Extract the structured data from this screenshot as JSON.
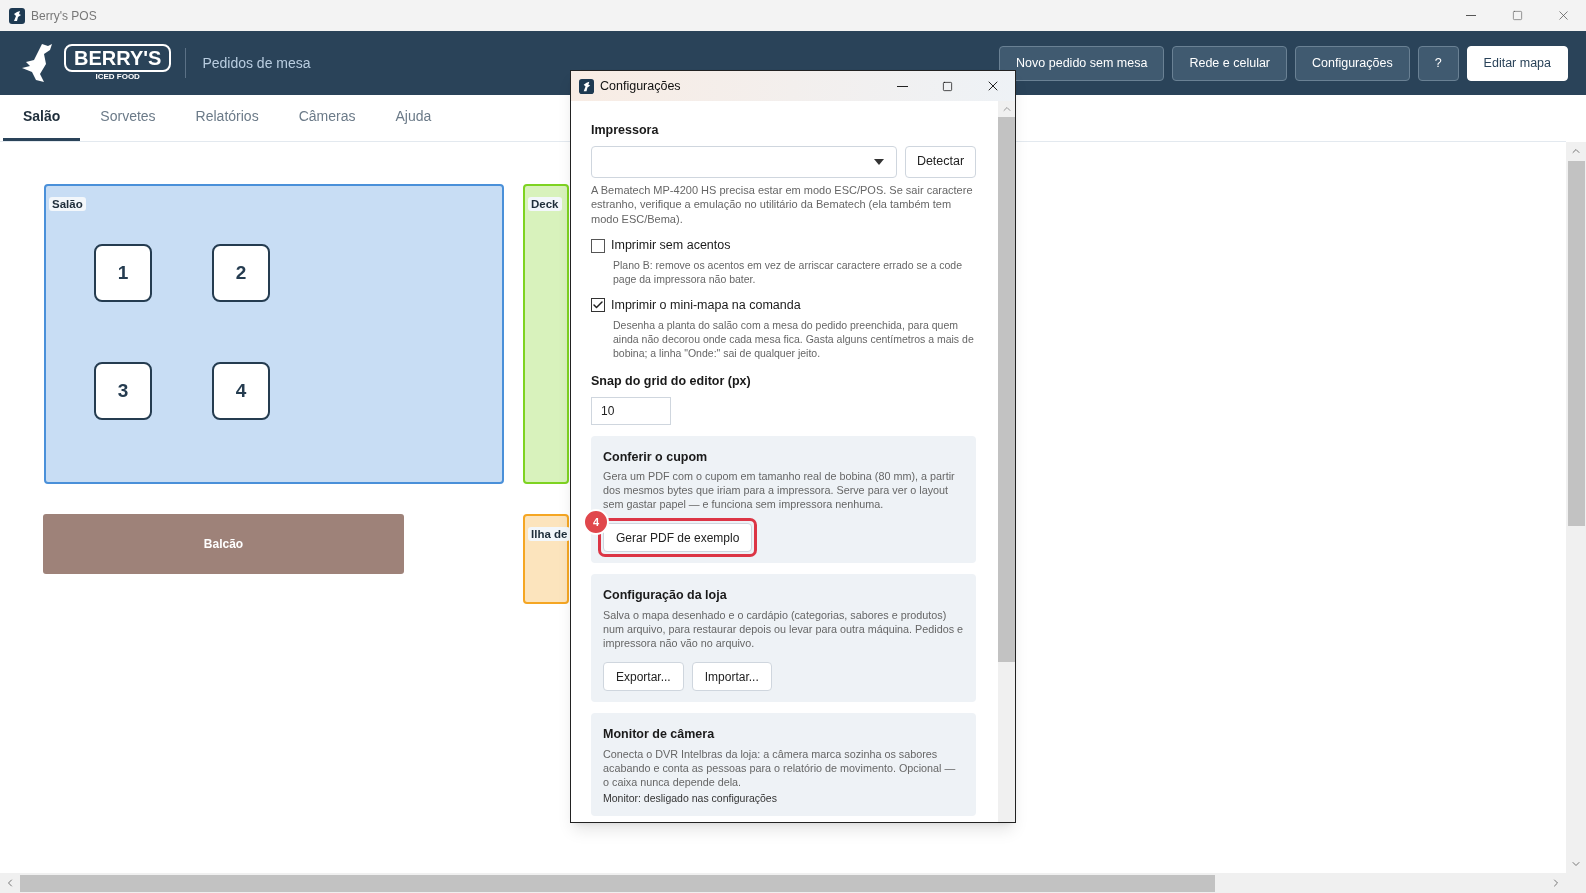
{
  "window": {
    "title": "Berry's POS"
  },
  "header": {
    "logo": {
      "name": "BERRY'S",
      "tagline": "ICED FOOD"
    },
    "subtitle": "Pedidos de mesa",
    "buttons": [
      {
        "label": "Novo pedido sem mesa",
        "kind": "outline"
      },
      {
        "label": "Rede e celular",
        "kind": "outline"
      },
      {
        "label": "Configurações",
        "kind": "outline"
      },
      {
        "label": "?",
        "kind": "outline"
      },
      {
        "label": "Editar mapa",
        "kind": "primary"
      }
    ]
  },
  "tabs": [
    {
      "label": "Salão",
      "selected": true
    },
    {
      "label": "Sorvetes",
      "selected": false
    },
    {
      "label": "Relatórios",
      "selected": false
    },
    {
      "label": "Câmeras",
      "selected": false
    },
    {
      "label": "Ajuda",
      "selected": false
    }
  ],
  "map": {
    "areas": [
      {
        "kind": "zone",
        "name": "Salão",
        "color": "#4a90d9",
        "tables": [
          "1",
          "2",
          "3",
          "4"
        ]
      },
      {
        "kind": "zone",
        "name": "Deck",
        "color": "#7ed321"
      },
      {
        "kind": "zone",
        "name": "Ilha de",
        "color": "#f5a623"
      },
      {
        "kind": "counter",
        "name": "Balcão",
        "color": "#9e8279"
      }
    ]
  },
  "dialog": {
    "title": "Configurações",
    "printer": {
      "label": "Impressora",
      "button": "Detectar",
      "help": "A Bematech MP-4200 HS precisa estar em modo ESC/POS. Se sair caractere estranho, verifique a emulação no utilitário da Bematech (ela também tem modo ESC/Bema)."
    },
    "options": [
      {
        "label": "Imprimir sem acentos",
        "checked": false,
        "help": "Plano B: remove os acentos em vez de arriscar caractere errado se a code page da impressora não bater."
      },
      {
        "label": "Imprimir o mini-mapa na comanda",
        "checked": true,
        "help": "Desenha a planta do salão com a mesa do pedido preenchida, para quem ainda não decorou onde cada mesa fica. Gasta alguns centímetros a mais de bobina; a linha \"Onde:\" sai de qualquer jeito."
      }
    ],
    "snap": {
      "label": "Snap do grid do editor (px)",
      "value": "10"
    },
    "cards": [
      {
        "title": "Conferir o cupom",
        "text": "Gera um PDF com o cupom em tamanho real de bobina (80 mm), a partir dos mesmos bytes que iriam para a impressora. Serve para ver o layout sem gastar papel — e funciona sem impressora nenhuma.",
        "buttons": [
          {
            "label": "Gerar PDF de exemplo",
            "highlighted": true,
            "step": "4"
          }
        ]
      },
      {
        "title": "Configuração da loja",
        "text": "Salva o mapa desenhado e o cardápio (categorias, sabores e produtos) num arquivo, para restaurar depois ou levar para outra máquina. Pedidos e impressora não vão no arquivo.",
        "buttons": [
          {
            "label": "Exportar...",
            "highlighted": false
          },
          {
            "label": "Importar...",
            "highlighted": false
          }
        ]
      },
      {
        "title": "Monitor de câmera",
        "text": "Conecta o DVR Intelbras da loja: a câmera marca sozinha os sabores acabando e conta as pessoas para o relatório de movimento. Opcional — o caixa nunca depende dela.",
        "status": "Monitor: desligado nas configurações"
      }
    ]
  }
}
